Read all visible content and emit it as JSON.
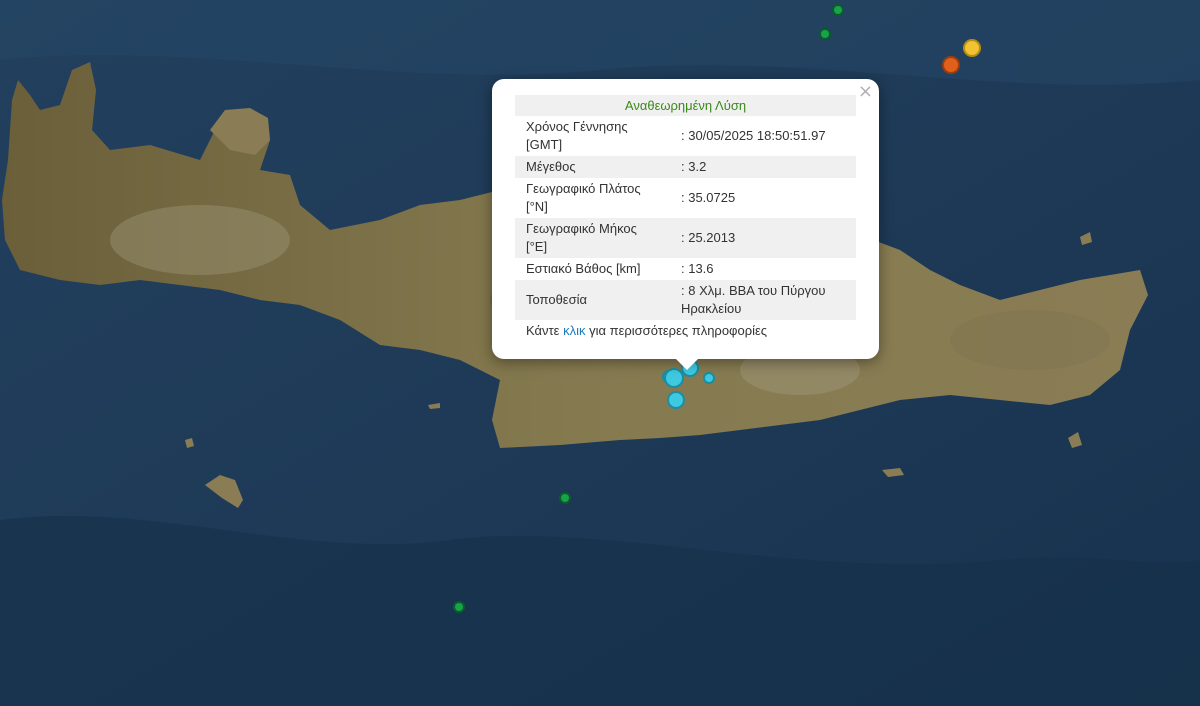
{
  "popup": {
    "title": "Αναθεωρημένη Λύση",
    "close_label": "×",
    "rows": [
      {
        "label": "Χρόνος Γέννησης [GMT]",
        "value": ": 30/05/2025 18:50:51.97"
      },
      {
        "label": "Μέγεθος",
        "value": ": 3.2"
      },
      {
        "label": "Γεωγραφικό Πλάτος [°N]",
        "value": ": 35.0725"
      },
      {
        "label": "Γεωγραφικό Μήκος [°E]",
        "value": ": 25.2013"
      },
      {
        "label": "Εστιακό Βάθος [km]",
        "value": ": 13.6"
      },
      {
        "label": "Τοποθεσία",
        "value": ": 8 Χλμ. ΒΒΑ του Πύργου Ηρακλείου"
      }
    ],
    "more_prefix": "Κάντε ",
    "more_link": "κλικ",
    "more_suffix": " για περισσότερες πληροφορίες"
  },
  "colors": {
    "sea": "#1f3a55",
    "land": "#7a7046",
    "marker_recent": "#3ec9e0",
    "marker_old": "#16a34a",
    "marker_orange": "#e0601b",
    "marker_yellow": "#f1c232",
    "title_green": "#3a8a1a",
    "link_blue": "#1f7ab5"
  }
}
